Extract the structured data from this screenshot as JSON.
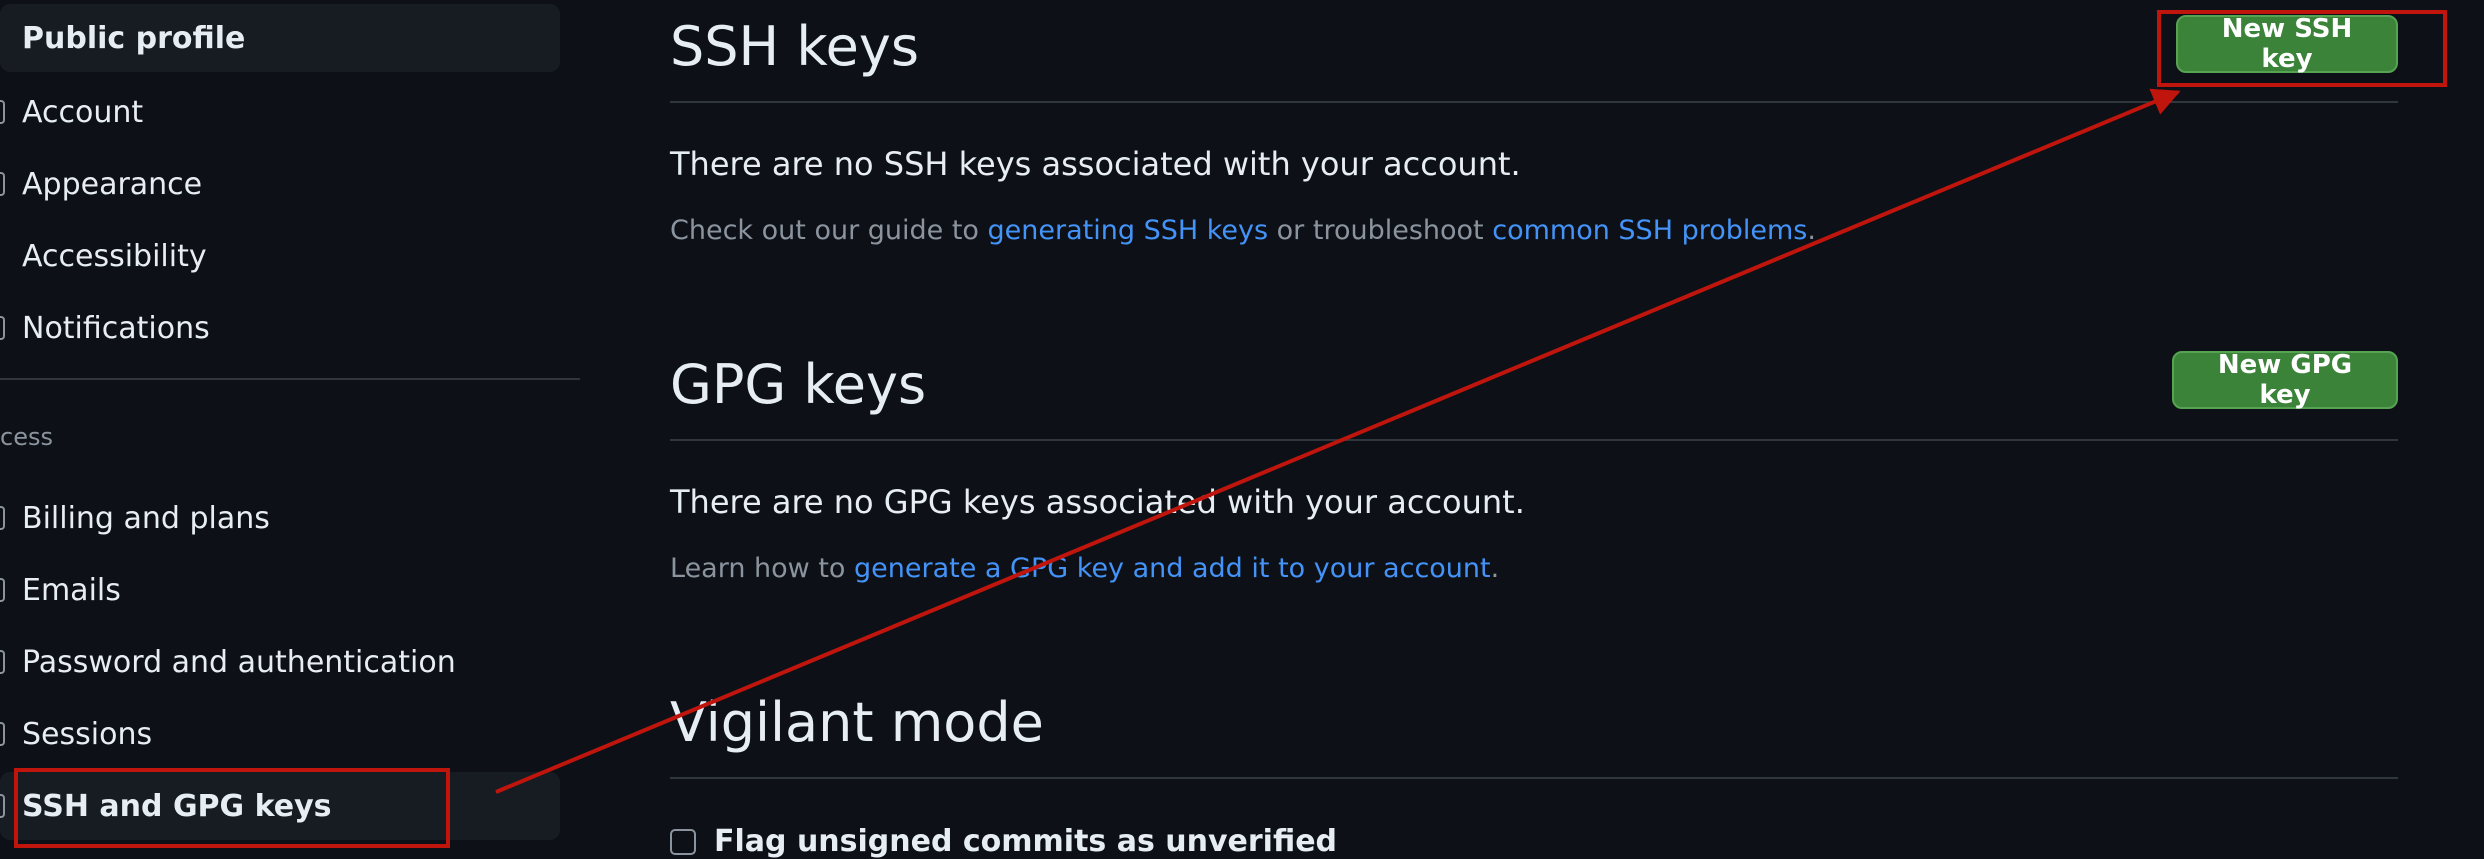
{
  "sidebar": {
    "items_top": [
      {
        "label": "Public profile"
      },
      {
        "label": "Account"
      },
      {
        "label": "Appearance"
      },
      {
        "label": "Accessibility"
      },
      {
        "label": "Notifications"
      }
    ],
    "section_heading": "cess",
    "items_access": [
      {
        "label": "Billing and plans"
      },
      {
        "label": "Emails"
      },
      {
        "label": "Password and authentication"
      },
      {
        "label": "Sessions"
      },
      {
        "label": "SSH and GPG keys"
      }
    ]
  },
  "ssh": {
    "title": "SSH keys",
    "button": "New SSH key",
    "empty_text": "There are no SSH keys associated with your account.",
    "help_prefix": "Check out our guide to ",
    "help_link1": "generating SSH keys",
    "help_middle": " or troubleshoot ",
    "help_link2": "common SSH problems",
    "help_suffix": "."
  },
  "gpg": {
    "title": "GPG keys",
    "button": "New GPG key",
    "empty_text": "There are no GPG keys associated with your account.",
    "help_prefix": "Learn how to ",
    "help_link": "generate a GPG key and add it to your account",
    "help_suffix": "."
  },
  "vigilant": {
    "title": "Vigilant mode",
    "checkbox_label": "Flag unsigned commits as unverified",
    "checked": false
  },
  "annotation": {
    "color": "#c0150d"
  },
  "colors": {
    "background": "#0d1117",
    "button_green": "#3a8339",
    "link_blue": "#4493f8",
    "muted_text": "#8b949e"
  }
}
